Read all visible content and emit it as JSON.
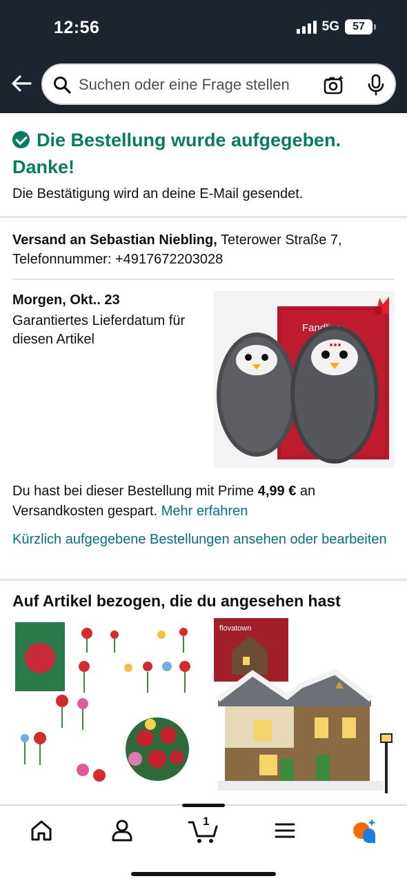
{
  "status_bar": {
    "time": "12:56",
    "network": "5G",
    "battery": "57"
  },
  "search": {
    "placeholder": "Suchen oder eine Frage stellen"
  },
  "confirmation": {
    "title": "Die Bestellung wurde aufgegeben. Danke!",
    "email_note": "Die Bestätigung wird an deine E-Mail gesendet."
  },
  "shipping": {
    "label": "Versand an Sebastian Niebling,",
    "address": "Teterower Straße 7,",
    "phone": "Telefonnummer: +4917672203028"
  },
  "delivery": {
    "date": "Morgen, Okt.. 23",
    "note": "Garantiertes Lieferdatum für diesen Artikel",
    "product_brand": "Fandliss"
  },
  "savings": {
    "text_before": "Du hast bei dieser Bestellung mit Prime",
    "amount": "4,99 €",
    "text_after": "an Versandkosten gespart.",
    "link": "Mehr erfahren"
  },
  "recent_orders_link": "Kürzlich aufgegebene Bestellungen ansehen oder bearbeiten",
  "related": {
    "heading": "Auf Artikel bezogen, die du angesehen hast",
    "item2_brand": "flovatown"
  },
  "bottom_nav": {
    "cart_count": "1"
  },
  "colors": {
    "header_bg": "#1c2430",
    "success_green": "#067d62",
    "link_teal": "#007185",
    "prime_accent": "#ff6a00"
  }
}
